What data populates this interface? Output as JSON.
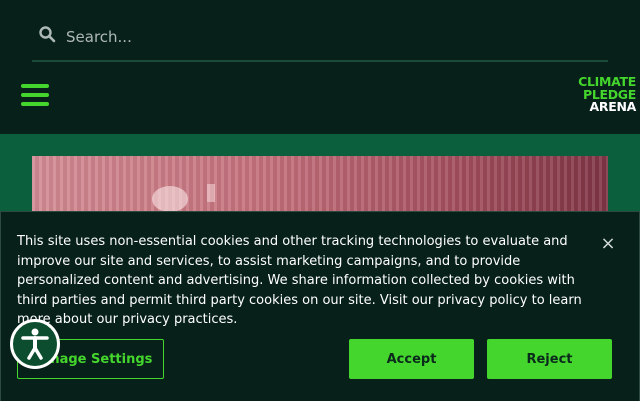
{
  "search": {
    "placeholder": "Search..."
  },
  "logo": {
    "line1": "CLIMATE",
    "line2": "PLEDGE",
    "line3": "ARENA"
  },
  "cookie_banner": {
    "text": "This site uses non-essential cookies and other tracking technologies to evaluate and improve our site and services, to assist marketing campaigns, and to provide personalized content and advertising. We share information collected by cookies with third parties and permit third party cookies on our site. Visit our privacy policy to learn more about our privacy practices.",
    "close_label": "×",
    "manage_label": "Manage Settings",
    "accept_label": "Accept",
    "reject_label": "Reject"
  },
  "colors": {
    "accent": "#44d62c",
    "header_bg": "#07201a",
    "page_bg": "#0b5f3c"
  },
  "icons": [
    "search-icon",
    "hamburger-menu-icon",
    "close-icon",
    "accessibility-icon"
  ]
}
